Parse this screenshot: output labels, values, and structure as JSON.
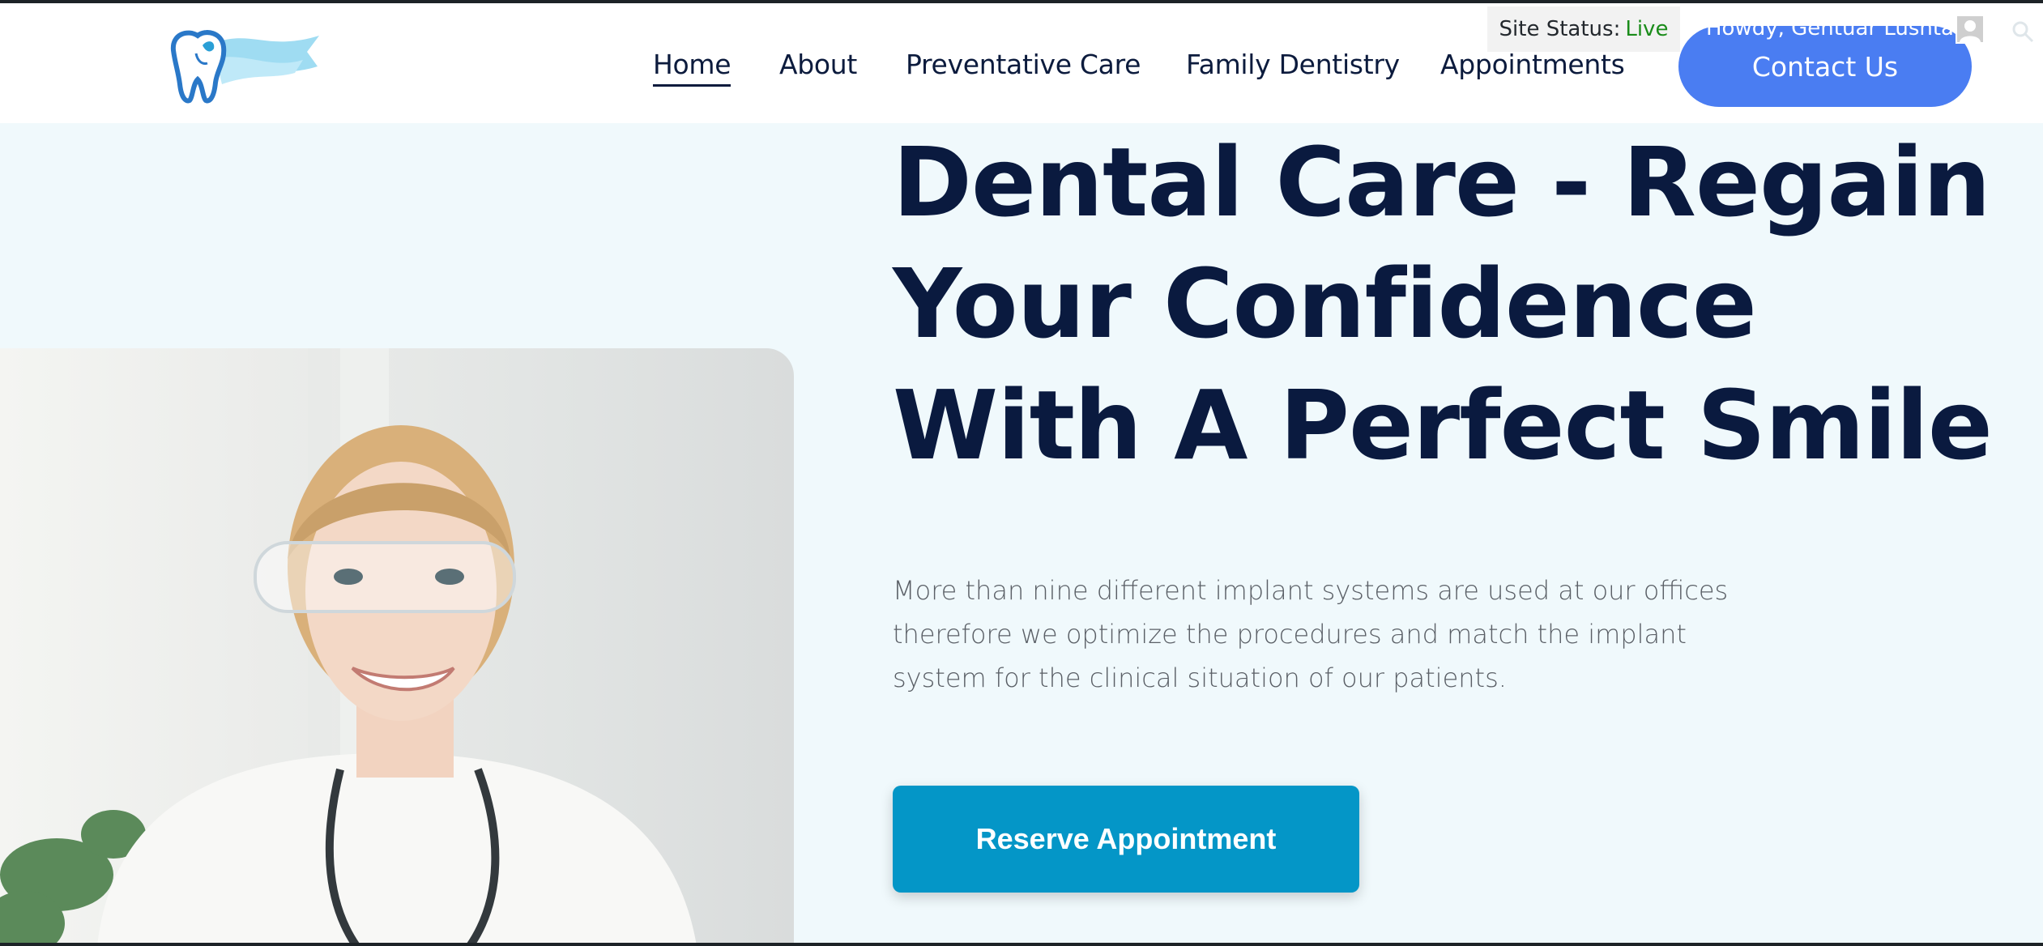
{
  "nav": {
    "items": [
      {
        "label": "Home",
        "active": true
      },
      {
        "label": "About",
        "active": false
      },
      {
        "label": "Preventative Care",
        "active": false
      },
      {
        "label": "Family Dentistry",
        "active": false
      },
      {
        "label": "Appointments",
        "active": false
      }
    ],
    "contact_label": "Contact Us"
  },
  "admin_bar": {
    "status_label": "Site Status:",
    "status_value": "Live",
    "howdy": "Howdy, Gentuar Lushtaku"
  },
  "hero": {
    "title_lines": [
      "Dental Care - Regain",
      "Your Confidence",
      "With A Perfect Smile"
    ],
    "description": "More than nine different implant systems are used at our offices therefore we optimize the procedures and match the implant system for the clinical situation of our patients.",
    "cta_label": "Reserve Appointment"
  },
  "colors": {
    "primary_blue": "#4a7df2",
    "cta_teal": "#0496c7",
    "heading_navy": "#0a1a3f",
    "hero_bg": "#f0f9fc",
    "live_green": "#1a8c1a"
  },
  "icons": {
    "logo": "tooth-logo-icon",
    "search": "search-icon",
    "avatar": "user-avatar-icon"
  }
}
